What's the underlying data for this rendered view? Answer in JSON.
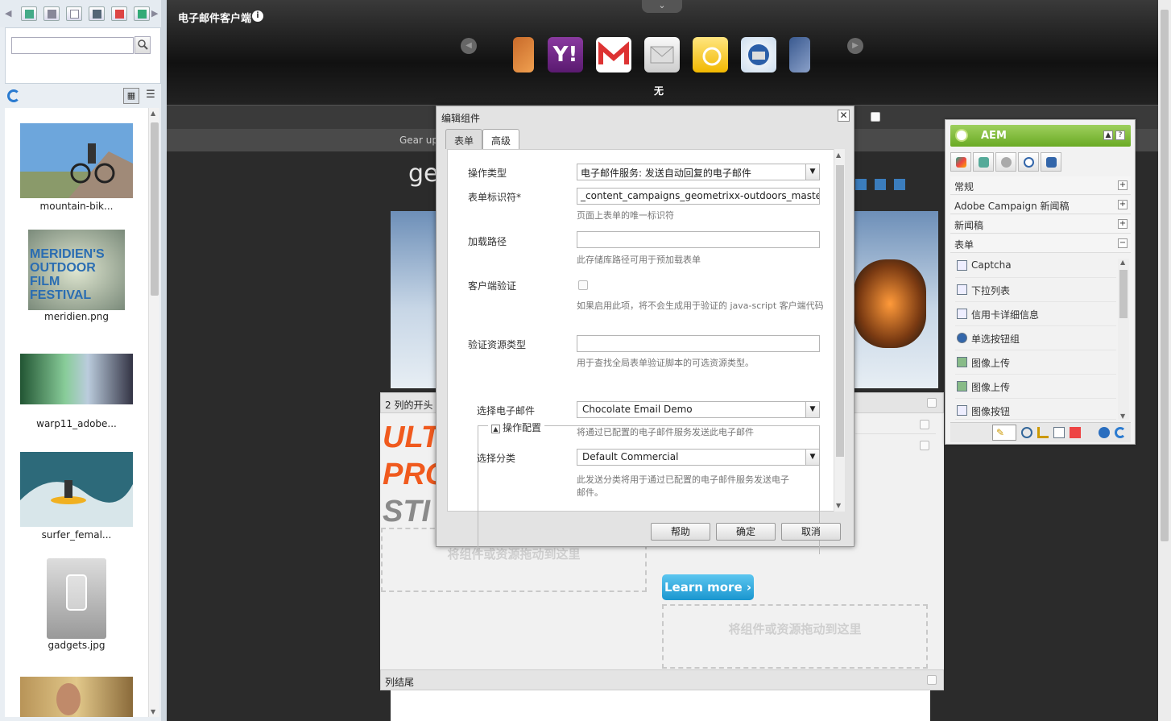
{
  "left_panel": {
    "toolbar_icons": [
      "back-arrow-icon",
      "image-icon",
      "document-icon",
      "page-icon",
      "film-icon",
      "s7-icon",
      "flash-icon",
      "forward-arrow-icon"
    ],
    "search": {
      "value": "",
      "placeholder": ""
    },
    "assets": [
      {
        "name": "mountain-bik..."
      },
      {
        "name": "meridien.png",
        "thumb_text": "MERIDIEN'S OUTDOOR FILM FESTIVAL"
      },
      {
        "name": "warp11_adobe..."
      },
      {
        "name": "surfer_femal..."
      },
      {
        "name": "gadgets.jpg"
      },
      {
        "name": ""
      }
    ]
  },
  "topbar": {
    "title": "电子邮件客户端",
    "client_label": "无",
    "clients": [
      "yahoo-icon",
      "gmail-icon",
      "generic-mail-icon",
      "outlook-icon",
      "thunderbird-icon"
    ]
  },
  "page": {
    "nav_text": "Gear up",
    "logo_text": "ge",
    "column_start": "2 列的开头",
    "column_end": "列结尾",
    "headline_lines": [
      "ULT",
      "PRO",
      "STI"
    ],
    "drop_text": "将组件或资源拖动到这里",
    "learn_more": "Learn more ›"
  },
  "dialog": {
    "title": "编辑组件",
    "tabs": [
      "表单",
      "高级"
    ],
    "active_tab": "高级",
    "fields": {
      "action_type_label": "操作类型",
      "action_type_value": "电子邮件服务: 发送自动回复的电子邮件",
      "form_id_label": "表单标识符*",
      "form_id_value": "_content_campaigns_geometrixx-outdoors_master_e-m",
      "form_id_hint": "页面上表单的唯一标识符",
      "load_path_label": "加载路径",
      "load_path_value": "",
      "load_path_hint": "此存储库路径可用于预加载表单",
      "client_validation_label": "客户端验证",
      "client_validation_hint": "如果启用此项，将不会生成用于验证的 java-script 客户端代码",
      "validation_type_label": "验证资源类型",
      "validation_type_value": "",
      "validation_type_hint": "用于查找全局表单验证脚本的可选资源类型。"
    },
    "fieldset": {
      "legend": "操作配置",
      "email_label": "选择电子邮件",
      "email_value": "Chocolate Email Demo",
      "email_hint": "将通过已配置的电子邮件服务发送此电子邮件",
      "category_label": "选择分类",
      "category_value": "Default Commercial",
      "category_hint": "此发送分类将用于通过已配置的电子邮件服务发送电子邮件。"
    },
    "buttons": {
      "help": "帮助",
      "ok": "确定",
      "cancel": "取消"
    }
  },
  "sidekick": {
    "title": "AEM",
    "groups": [
      {
        "label": "常规",
        "state": "+"
      },
      {
        "label": "Adobe Campaign 新闻稿",
        "state": "+"
      },
      {
        "label": "新闻稿",
        "state": "+"
      },
      {
        "label": "表单",
        "state": "−"
      }
    ],
    "items": [
      "Captcha",
      "下拉列表",
      "信用卡详细信息",
      "单选按钮组",
      "图像上传",
      "图像上传",
      "图像按钮"
    ]
  }
}
